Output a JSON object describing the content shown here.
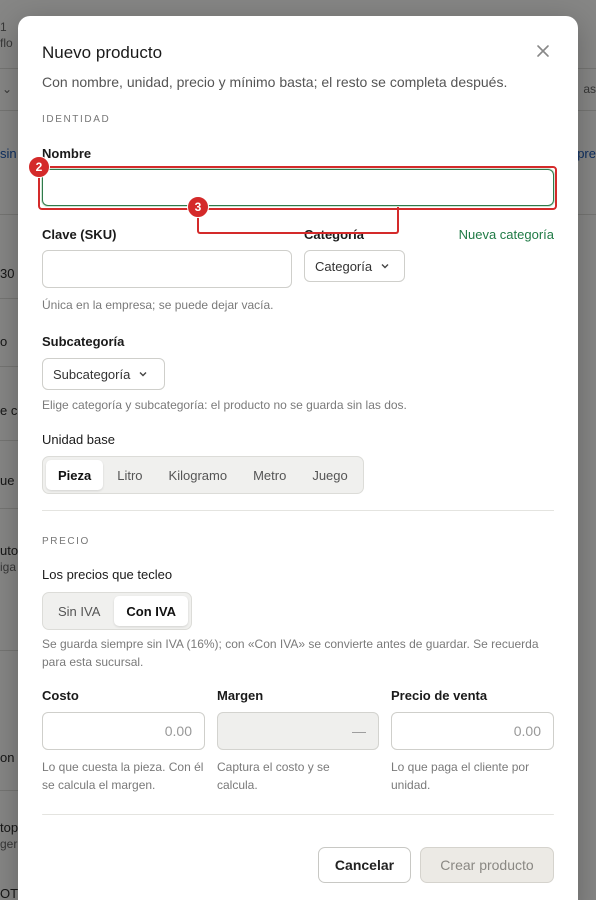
{
  "background": {
    "fragments": [
      "1",
      "flo",
      "sin",
      "mpre",
      "30",
      "o",
      "e c",
      "ue",
      "uto",
      "iga",
      "on",
      "top",
      "geri",
      "OT a",
      "as"
    ]
  },
  "modal": {
    "title": "Nuevo producto",
    "subtitle": "Con nombre, unidad, precio y mínimo basta; el resto se completa después.",
    "close_icon": "close-icon",
    "sections": {
      "identity": "IDENTIDAD",
      "price": "PRECIO"
    },
    "fields": {
      "nombre": {
        "label": "Nombre",
        "value": ""
      },
      "sku": {
        "label": "Clave (SKU)",
        "value": "",
        "help": "Única en la empresa; se puede dejar vacía."
      },
      "categoria": {
        "label": "Categoría",
        "selected": "Categoría",
        "new_link": "Nueva categoría"
      },
      "subcategoria": {
        "label": "Subcategoría",
        "selected": "Subcategoría",
        "help": "Elige categoría y subcategoría: el producto no se guarda sin las dos."
      },
      "unidad": {
        "label": "Unidad base",
        "options": [
          "Pieza",
          "Litro",
          "Kilogramo",
          "Metro",
          "Juego"
        ],
        "selected": "Pieza"
      },
      "precios": {
        "label": "Los precios que tecleo",
        "options": [
          "Sin IVA",
          "Con IVA"
        ],
        "selected": "Con IVA",
        "help": "Se guarda siempre sin IVA (16%); con «Con IVA» se convierte antes de guardar. Se recuerda para esta sucursal."
      },
      "costo": {
        "label": "Costo",
        "placeholder": "0.00",
        "help": "Lo que cuesta la pieza. Con él se calcula el margen."
      },
      "margen": {
        "label": "Margen",
        "placeholder": "—",
        "help": "Captura el costo y se calcula."
      },
      "venta": {
        "label": "Precio de venta",
        "placeholder": "0.00",
        "help": "Lo que paga el cliente por unidad."
      }
    },
    "buttons": {
      "cancel": "Cancelar",
      "create": "Crear producto"
    }
  },
  "annotations": [
    {
      "label": "2"
    },
    {
      "label": "3"
    }
  ],
  "colors": {
    "accent_green": "#1f7a45",
    "annotation_red": "#d42a2a"
  }
}
